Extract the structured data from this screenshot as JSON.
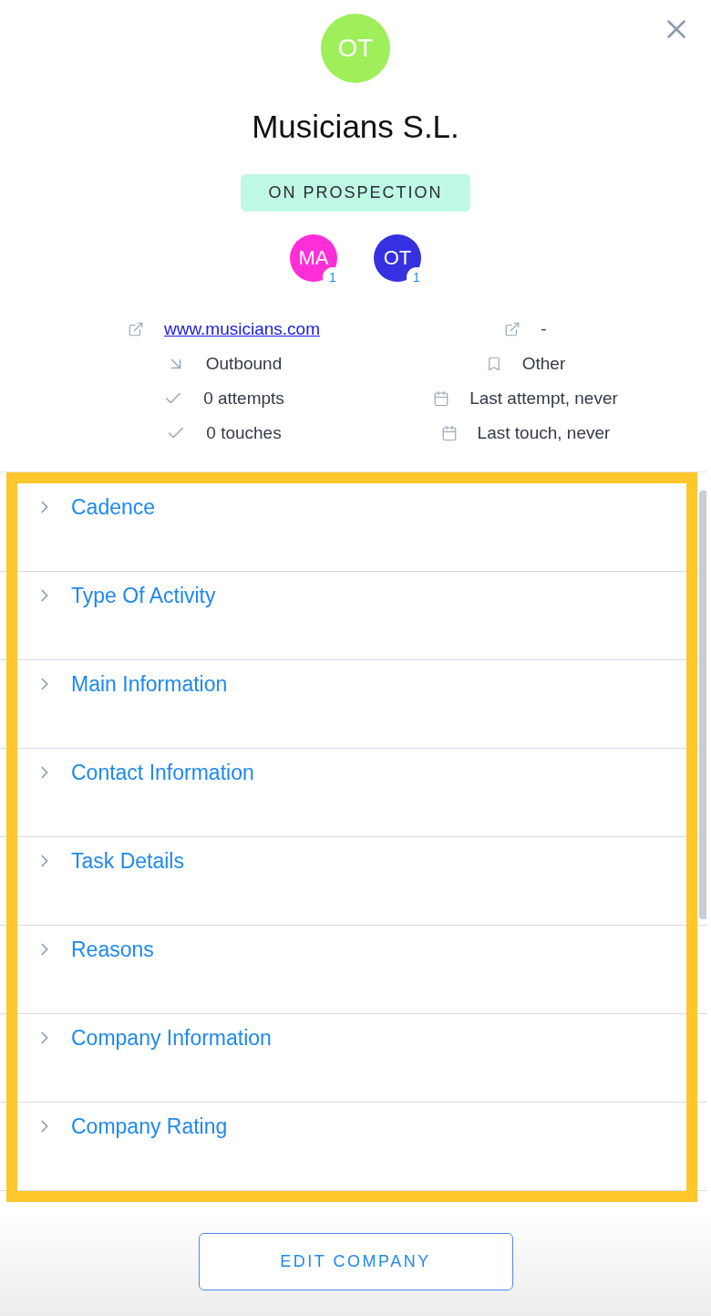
{
  "avatar": {
    "initials": "OT",
    "color": "#9eef5a"
  },
  "company": {
    "name": "Musicians S.L.",
    "status": "ON PROSPECTION"
  },
  "owners": [
    {
      "initials": "MA",
      "color": "#ff2fd8",
      "count": "1"
    },
    {
      "initials": "OT",
      "color": "#3530e0",
      "count": "1"
    }
  ],
  "info": [
    {
      "left": {
        "kind": "website",
        "text": "www.musicians.com"
      },
      "right": {
        "kind": "external",
        "text": "-"
      }
    },
    {
      "left": {
        "kind": "source",
        "text": "Outbound"
      },
      "right": {
        "kind": "category",
        "text": "Other"
      }
    },
    {
      "left": {
        "kind": "count",
        "text": "0 attempts"
      },
      "right": {
        "kind": "date",
        "text": "Last attempt, never"
      }
    },
    {
      "left": {
        "kind": "count",
        "text": "0 touches"
      },
      "right": {
        "kind": "date",
        "text": "Last touch, never"
      }
    }
  ],
  "sections": [
    {
      "label": "Cadence",
      "expanded": false
    },
    {
      "label": "Type Of Activity",
      "expanded": false
    },
    {
      "label": "Main Information",
      "expanded": false
    },
    {
      "label": "Contact Information",
      "expanded": false
    },
    {
      "label": "Task Details",
      "expanded": false
    },
    {
      "label": "Reasons",
      "expanded": false
    },
    {
      "label": "Company Information",
      "expanded": false
    },
    {
      "label": "Company Rating",
      "expanded": false
    }
  ],
  "edit_button": "EDIT COMPANY"
}
